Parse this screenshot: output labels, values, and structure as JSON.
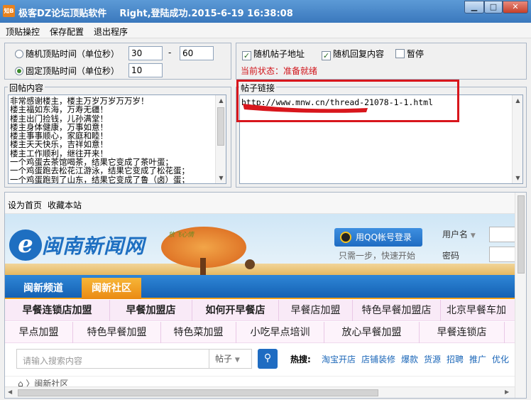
{
  "window": {
    "app_icon": "知B",
    "title": "极客DZ论坛顶贴软件",
    "status_title": "Right,登陆成功.2015-6-19 16:38:08",
    "min": "▁",
    "max": "□",
    "close": "✕"
  },
  "menu": [
    "顶贴操控",
    "保存配置",
    "退出程序"
  ],
  "timing": {
    "random_label": "随机顶贴时间（单位秒）",
    "random_min": "30",
    "dash": "-",
    "random_max": "60",
    "fixed_label": "固定顶贴时间（单位秒）",
    "fixed_value": "10"
  },
  "options": {
    "random_url": "随机帖子地址",
    "random_reply": "随机回复内容",
    "pause": "暂停",
    "status": "当前状态：准备就绪"
  },
  "reply": {
    "legend": "回帖内容",
    "lines": [
      "非常感谢楼主，楼主万岁万岁万万岁！",
      "楼主福如东海，万寿无疆！",
      "楼主出门捡钱，儿孙满堂！",
      "楼主身体健康，万事如意！",
      "楼主事事顺心，家庭和睦！",
      "楼主天天快乐，吉祥如意！",
      "楼主工作顺利，继往开来！",
      "一个鸡蛋去茶馆喝茶，结果它变成了茶叶蛋；",
      "一个鸡蛋跑去松花江游泳，结果它变成了松花蛋；",
      "一个鸡蛋跑到了山东，结果它变成了鲁（卤）蛋；"
    ]
  },
  "link": {
    "legend": "帖子链接",
    "url": "http://www.mnw.cn/thread-21078-1-1.html"
  },
  "browser": {
    "toolbar": [
      "设为首页",
      "收藏本站"
    ],
    "site_name": "闽南新闻网",
    "slogan": "放飞心情",
    "qq_login": "用QQ帐号登录",
    "qq_hint": "只需一步，快速开始",
    "username_label": "用户名",
    "password_label": "密码",
    "nav": [
      "闽新频道",
      "闽新社区"
    ],
    "tags_row1": [
      "早餐连锁店加盟",
      "早餐加盟店",
      "如何开早餐店",
      "早餐店加盟",
      "特色早餐加盟店",
      "北京早餐车加"
    ],
    "tags_row2": [
      "早点加盟",
      "特色早餐加盟",
      "特色菜加盟",
      "小吃早点培训",
      "放心早餐加盟",
      "早餐连锁店"
    ],
    "search_placeholder": "请输入搜索内容",
    "search_type": "帖子",
    "hot_label": "热搜:",
    "hot": [
      "淘宝开店",
      "店铺装修",
      "爆款",
      "货源",
      "招聘",
      "推广",
      "优化"
    ],
    "breadcrumb": "⌂ 〉闽新社区"
  }
}
